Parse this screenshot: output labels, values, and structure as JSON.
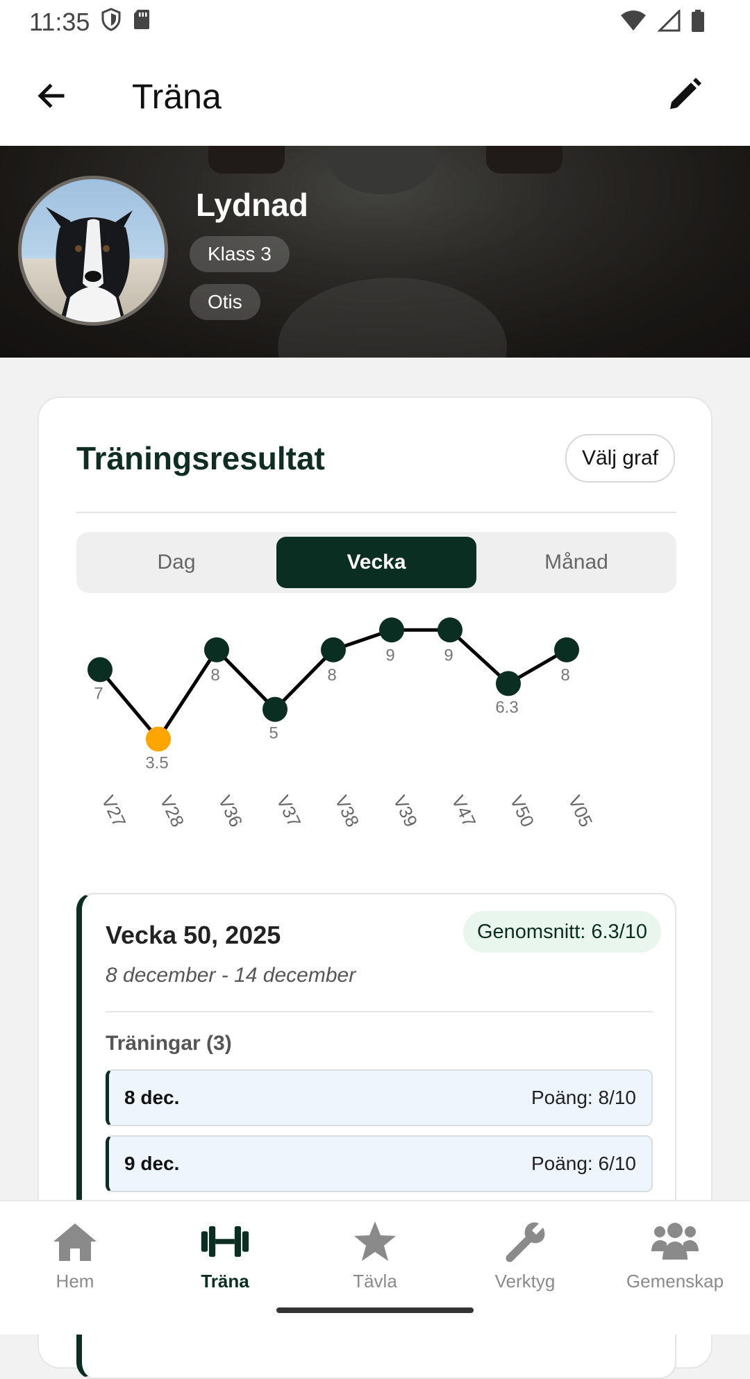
{
  "status_bar": {
    "time": "11:35"
  },
  "app_bar": {
    "title": "Träna"
  },
  "hero": {
    "name": "Lydnad",
    "chips": [
      "Klass 3",
      "Otis"
    ]
  },
  "card": {
    "title": "Träningsresultat",
    "pick_graph_label": "Välj graf",
    "tabs": [
      {
        "label": "Dag",
        "active": false
      },
      {
        "label": "Vecka",
        "active": true
      },
      {
        "label": "Månad",
        "active": false
      }
    ]
  },
  "chart_data": {
    "type": "line",
    "categories": [
      "V27",
      "V28",
      "V36",
      "V37",
      "V38",
      "V39",
      "V47",
      "V50",
      "V05"
    ],
    "values": [
      7,
      3.5,
      8,
      5,
      8,
      9,
      9,
      6.3,
      8
    ],
    "value_labels": [
      "7",
      "3.5",
      "8",
      "5",
      "8",
      "9",
      "9",
      "6.3",
      "8"
    ],
    "highlight_index": 1,
    "colors": {
      "line": "#000000",
      "point": "#0b2e22",
      "highlight": "#ffa500",
      "label": "#777777"
    }
  },
  "detail": {
    "title": "Vecka 50, 2025",
    "range": "8 december - 14 december",
    "average": "Genomsnitt: 6.3/10",
    "sessions_label": "Träningar (3)",
    "sessions": [
      {
        "date": "8 dec.",
        "score": "Poäng: 8/10"
      },
      {
        "date": "9 dec.",
        "score": "Poäng: 6/10"
      }
    ]
  },
  "bottom_nav": [
    {
      "label": "Hem",
      "icon": "home-icon",
      "active": false
    },
    {
      "label": "Träna",
      "icon": "dumbbell-icon",
      "active": true
    },
    {
      "label": "Tävla",
      "icon": "star-icon",
      "active": false
    },
    {
      "label": "Verktyg",
      "icon": "wrench-icon",
      "active": false
    },
    {
      "label": "Gemenskap",
      "icon": "people-icon",
      "active": false
    }
  ],
  "colors": {
    "brand": "#0b2e22",
    "accent": "#ffa500"
  }
}
